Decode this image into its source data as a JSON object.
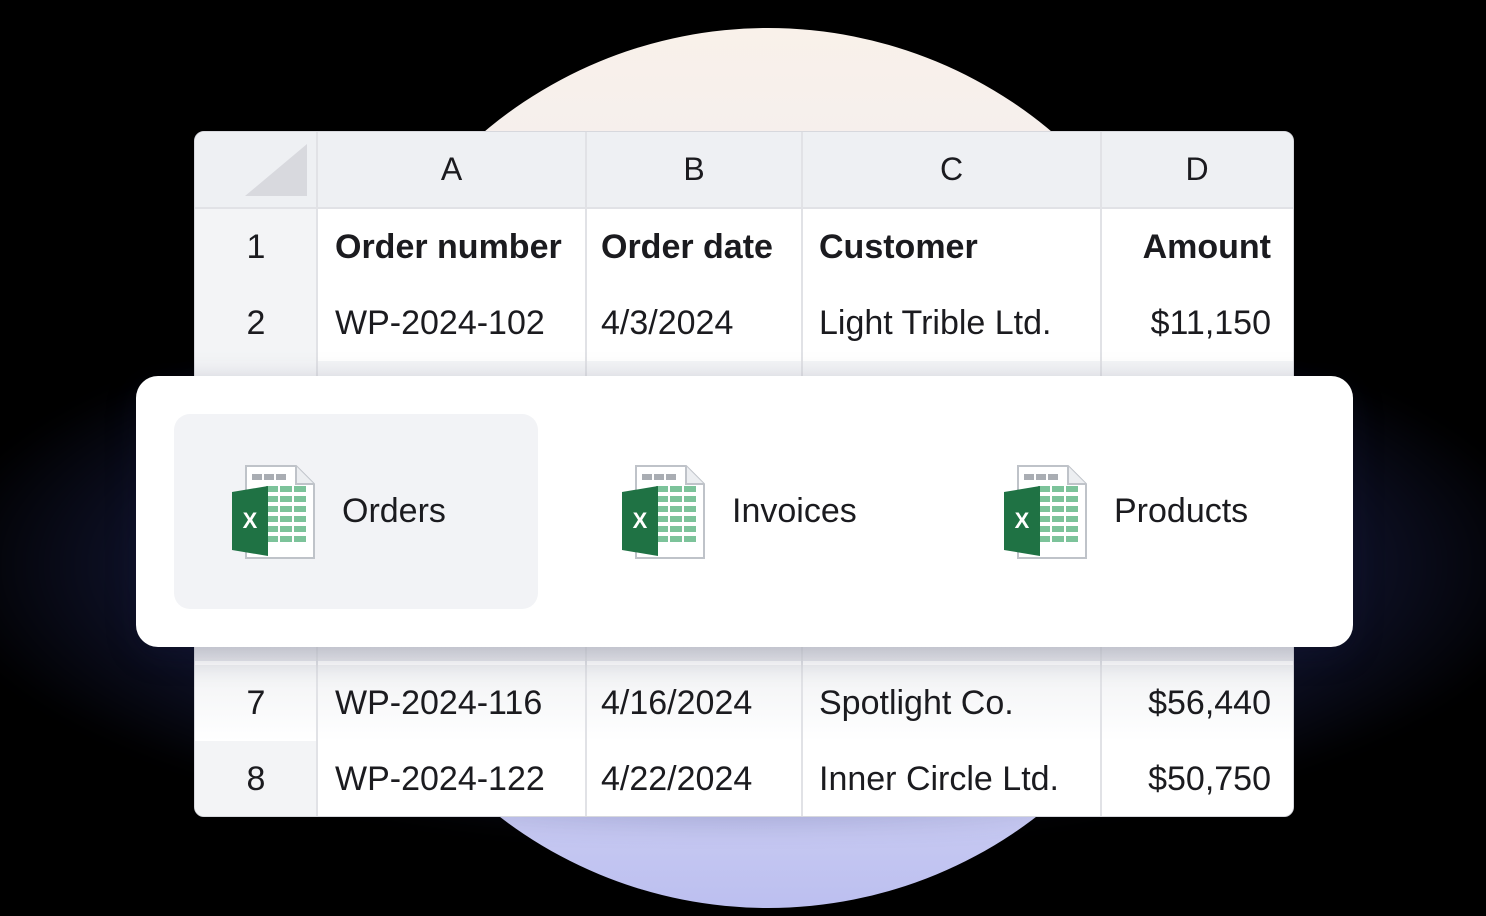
{
  "spreadsheet": {
    "columns": [
      "A",
      "B",
      "C",
      "D"
    ],
    "rows": [
      {
        "num": "1",
        "a": "Order number",
        "b": "Order date",
        "c": "Customer",
        "d": "Amount"
      },
      {
        "num": "2",
        "a": "WP-2024-102",
        "b": "4/3/2024",
        "c": "Light Trible Ltd.",
        "d": "$11,150"
      },
      {
        "num": "7",
        "a": "WP-2024-116",
        "b": "4/16/2024",
        "c": "Spotlight Co.",
        "d": "$56,440"
      },
      {
        "num": "8",
        "a": "WP-2024-122",
        "b": "4/22/2024",
        "c": "Inner Circle Ltd.",
        "d": "$50,750"
      }
    ]
  },
  "file_picker": {
    "files": [
      {
        "label": "Orders",
        "icon": "excel-file-icon",
        "selected": true
      },
      {
        "label": "Invoices",
        "icon": "excel-file-icon",
        "selected": false
      },
      {
        "label": "Products",
        "icon": "excel-file-icon",
        "selected": false
      }
    ]
  },
  "colors": {
    "excel_green": "#1f7244",
    "sheet_green": "#7cc39a",
    "selected_bg": "#f2f3f6"
  }
}
